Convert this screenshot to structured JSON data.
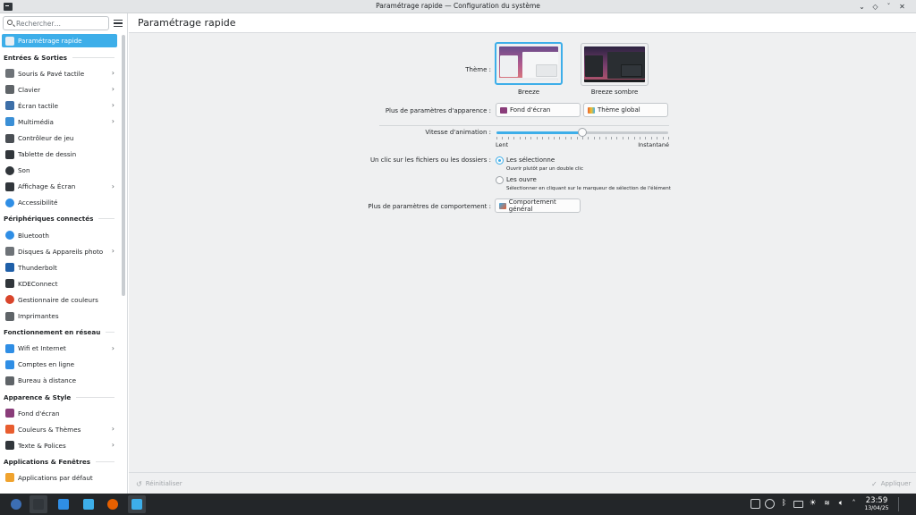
{
  "window": {
    "title": "Paramétrage rapide — Configuration du système",
    "controls": {
      "menu": "⌄",
      "keep_above": "◇",
      "minimize": "ˇ",
      "maximize": "ˆ",
      "close": "✕"
    }
  },
  "sidebar": {
    "search_placeholder": "Rechercher…",
    "active_item": "Paramétrage rapide",
    "sections": [
      {
        "title": "Entrées & Sorties",
        "items": [
          {
            "label": "Souris & Pavé tactile",
            "icon": "mouse-icon",
            "color": "#6e7378",
            "chevron": true
          },
          {
            "label": "Clavier",
            "icon": "keyboard-icon",
            "color": "#5f6468",
            "chevron": true
          },
          {
            "label": "Écran tactile",
            "icon": "touchscreen-icon",
            "color": "#3d6fa8",
            "chevron": true
          },
          {
            "label": "Multimédia",
            "icon": "multimedia-icon",
            "color": "#3a8fd6",
            "chevron": true
          },
          {
            "label": "Contrôleur de jeu",
            "icon": "gamepad-icon",
            "color": "#4a4f54",
            "chevron": false
          },
          {
            "label": "Tablette de dessin",
            "icon": "tablet-icon",
            "color": "#31363b",
            "chevron": false
          },
          {
            "label": "Son",
            "icon": "speaker-icon",
            "color": "#31363b",
            "chevron": false
          },
          {
            "label": "Affichage & Écran",
            "icon": "display-icon",
            "color": "#31363b",
            "chevron": true
          },
          {
            "label": "Accessibilité",
            "icon": "accessibility-icon",
            "color": "#2f8ee5",
            "chevron": false
          }
        ]
      },
      {
        "title": "Périphériques connectés",
        "items": [
          {
            "label": "Bluetooth",
            "icon": "bluetooth-icon",
            "color": "#2f8ee5",
            "chevron": false
          },
          {
            "label": "Disques & Appareils photo",
            "icon": "disk-icon",
            "color": "#6e7378",
            "chevron": true
          },
          {
            "label": "Thunderbolt",
            "icon": "thunderbolt-icon",
            "color": "#1f5fa8",
            "chevron": false
          },
          {
            "label": "KDEConnect",
            "icon": "kdeconnect-icon",
            "color": "#31363b",
            "chevron": false
          },
          {
            "label": "Gestionnaire de couleurs",
            "icon": "color-wheel-icon",
            "color": "#d9452b",
            "chevron": false
          },
          {
            "label": "Imprimantes",
            "icon": "printer-icon",
            "color": "#5f6468",
            "chevron": false
          }
        ]
      },
      {
        "title": "Fonctionnement en réseau",
        "items": [
          {
            "label": "Wifi et Internet",
            "icon": "wifi-globe-icon",
            "color": "#2f8ee5",
            "chevron": true
          },
          {
            "label": "Comptes en ligne",
            "icon": "online-accounts-icon",
            "color": "#2f8ee5",
            "chevron": false
          },
          {
            "label": "Bureau à distance",
            "icon": "remote-desktop-icon",
            "color": "#5f6468",
            "chevron": false
          }
        ]
      },
      {
        "title": "Apparence & Style",
        "items": [
          {
            "label": "Fond d'écran",
            "icon": "wallpaper-icon",
            "color": "#8a3d7a",
            "chevron": false
          },
          {
            "label": "Couleurs & Thèmes",
            "icon": "palette-icon",
            "color": "#e85d2f",
            "chevron": true
          },
          {
            "label": "Texte & Polices",
            "icon": "fonts-icon",
            "color": "#31363b",
            "chevron": true
          }
        ]
      },
      {
        "title": "Applications & Fenêtres",
        "items": [
          {
            "label": "Applications par défaut",
            "icon": "default-apps-icon",
            "color": "#f0a32e",
            "chevron": false
          }
        ]
      }
    ]
  },
  "main": {
    "page_title": "Paramétrage rapide",
    "theme_label": "Thème :",
    "themes": [
      {
        "name": "Breeze",
        "selected": true
      },
      {
        "name": "Breeze sombre",
        "selected": false
      }
    ],
    "appearance_label": "Plus de paramètres d'apparence :",
    "appearance_buttons": [
      {
        "label": "Fond d'écran",
        "icon": "wallpaper-icon",
        "color": "#8a3d7a"
      },
      {
        "label": "Thème global",
        "icon": "palette-icon",
        "color": "#e85d2f"
      }
    ],
    "animation_label": "Vitesse d'animation :",
    "animation_min": "Lent",
    "animation_max": "Instantané",
    "animation_value": 0.5,
    "click_label": "Un clic sur les fichiers ou les dossiers :",
    "click_options": [
      {
        "label": "Les sélectionne",
        "hint": "Ouvrir plutôt par un double clic",
        "checked": true
      },
      {
        "label": "Les ouvre",
        "hint": "Sélectionner en cliquant sur le marqueur de sélection de l'élément",
        "checked": false
      }
    ],
    "behavior_label": "Plus de paramètres de comportement :",
    "behavior_button": "Comportement général",
    "reset_label": "Réinitialiser",
    "apply_label": "Appliquer"
  },
  "taskbar": {
    "apps": [
      {
        "name": "Fedora launcher",
        "icon": "fedora-icon",
        "color": "#3c6eb4"
      },
      {
        "name": "Terminal",
        "icon": "terminal-icon",
        "color": "#31363b"
      },
      {
        "name": "Discover",
        "icon": "discover-icon",
        "color": "#2f8ee5"
      },
      {
        "name": "Dolphin",
        "icon": "folder-icon",
        "color": "#3daee9"
      },
      {
        "name": "Firefox",
        "icon": "firefox-icon",
        "color": "#e66000"
      },
      {
        "name": "System Settings",
        "icon": "settings-icon",
        "color": "#3daee9"
      }
    ],
    "time": "23:59",
    "date": "13/04/25"
  }
}
